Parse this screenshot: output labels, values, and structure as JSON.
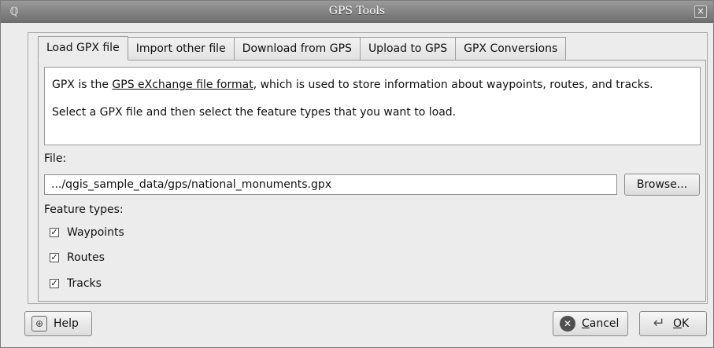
{
  "window": {
    "title": "GPS Tools",
    "app_icon": "qgis-icon",
    "close_glyph": "×"
  },
  "tabs": [
    {
      "label": "Load GPX file",
      "active": true
    },
    {
      "label": "Import other file",
      "active": false
    },
    {
      "label": "Download from GPS",
      "active": false
    },
    {
      "label": "Upload to GPS",
      "active": false
    },
    {
      "label": "GPX Conversions",
      "active": false
    }
  ],
  "info": {
    "line1_prefix": "GPX is the ",
    "line1_link": "GPS eXchange file format",
    "line1_suffix": ", which is used to store information about waypoints, routes, and tracks.",
    "line2": "Select a GPX file and then select the feature types that you want to load."
  },
  "file": {
    "label": "File:",
    "value": ".../qgis_sample_data/gps/national_monuments.gpx",
    "browse_label": "Browse..."
  },
  "feature_types": {
    "label": "Feature types:",
    "items": [
      {
        "label": "Waypoints",
        "checked": true
      },
      {
        "label": "Routes",
        "checked": true
      },
      {
        "label": "Tracks",
        "checked": true
      }
    ]
  },
  "buttons": {
    "help": "Help",
    "cancel_mnemonic": "C",
    "cancel_rest": "ancel",
    "ok_mnemonic": "O",
    "ok_rest": "K"
  },
  "glyphs": {
    "check": "✓",
    "help_icon": "help-icon",
    "cancel_icon": "cancel-icon",
    "ok_icon": "ok-icon"
  }
}
